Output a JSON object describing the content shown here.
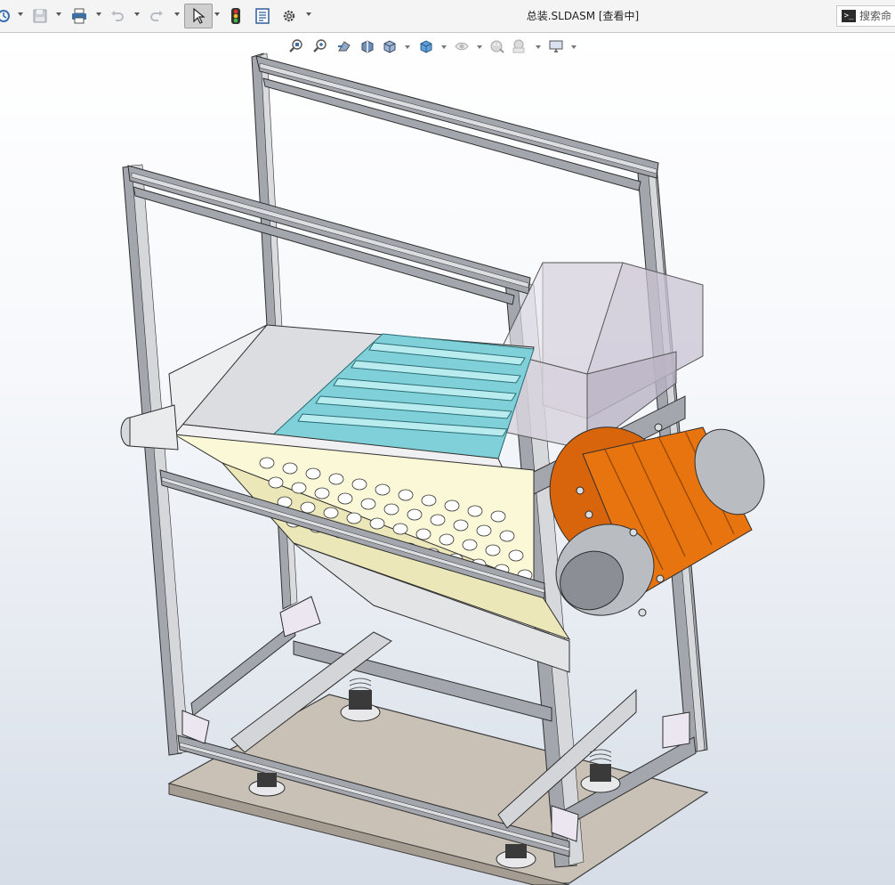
{
  "window": {
    "title": "总装.SLDASM [查看中]"
  },
  "toolbar": {
    "items": [
      {
        "name": "options-icon"
      },
      {
        "name": "save-icon"
      },
      {
        "name": "print-icon"
      },
      {
        "name": "undo-icon"
      },
      {
        "name": "redo-icon"
      },
      {
        "name": "select-icon"
      },
      {
        "name": "rebuild-traffic-light-icon"
      },
      {
        "name": "file-properties-icon"
      },
      {
        "name": "settings-gear-icon"
      }
    ]
  },
  "search": {
    "placeholder": "搜索命",
    "icon": "command-prompt-icon"
  },
  "heads_up_toolbar": {
    "items": [
      "zoom-to-fit-icon",
      "zoom-to-area-icon",
      "previous-view-icon",
      "section-view-icon",
      "view-orientation-icon",
      "display-style-icon",
      "hide-show-items-icon",
      "edit-appearance-icon",
      "apply-scene-icon",
      "view-settings-icon"
    ]
  },
  "model": {
    "colors": {
      "frame": "#a3a7ad",
      "frame_dark": "#5c6066",
      "hopper_glass": "#c9c3d3",
      "screen_panel": "#fbf8d8",
      "sieve_bars": "#7fd0d8",
      "motor_housing": "#e8740f",
      "motor_cap": "#b9bcc1",
      "base_plate": "#c9c1b6",
      "chute": "#e3e4e6"
    }
  }
}
